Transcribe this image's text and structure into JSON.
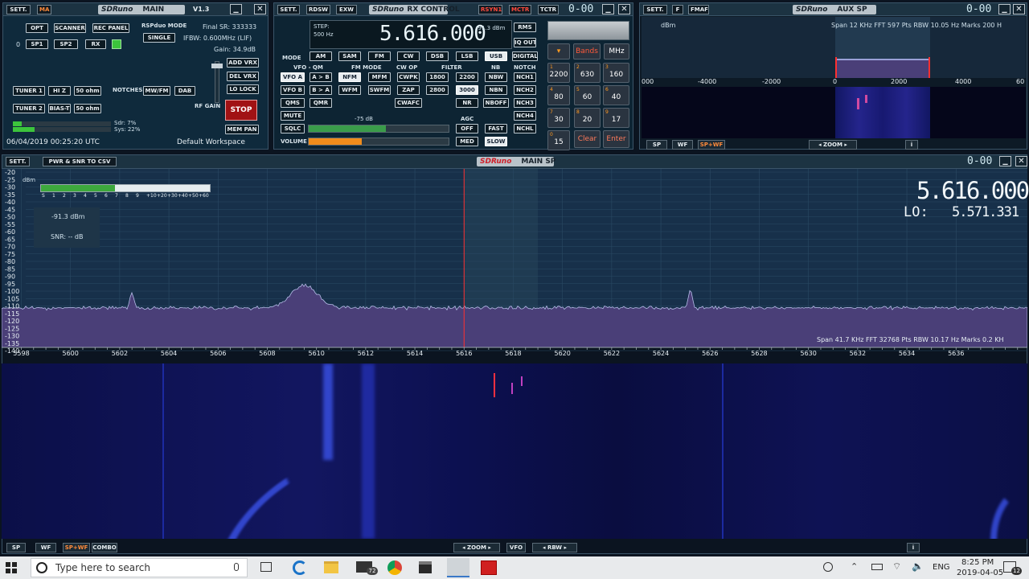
{
  "main_panel": {
    "sett": "SETT.",
    "ma": "MA",
    "logo": "SDRuno",
    "title": "MAIN",
    "version": "V1.3",
    "buttons": {
      "opt": "OPT",
      "scanner": "SCANNER",
      "rec_panel": "REC PANEL",
      "sp1": "SP1",
      "sp2": "SP2",
      "rx": "RX",
      "add_vrx": "ADD VRX",
      "del_vrx": "DEL VRX",
      "lo_lock": "LO LOCK",
      "stop": "STOP",
      "mem_pan": "MEM PAN",
      "tuner1": "TUNER 1",
      "hiz2": "HI Z",
      "ohm1": "50 ohm",
      "notches": "NOTCHES",
      "mwfm": "MW/FM",
      "dab": "DAB",
      "tuner2": "TUNER 2",
      "biast": "BIAS-T",
      "ohm2": "50 ohm",
      "single": "SINGLE"
    },
    "rx_index": "0",
    "rsp_mode_label": "RSPduo MODE",
    "final_sr": "Final SR: 333333",
    "ifbw": "IFBW: 0.600MHz (LIF)",
    "gain": "Gain: 34.9dB",
    "rf_gain_label": "RF GAIN",
    "sdr_load": "Sdr: 7%",
    "sys_load": "Sys: 22%",
    "datetime": "06/04/2019 00:25:20 UTC",
    "workspace": "Default Workspace"
  },
  "rx_control": {
    "sett": "SETT.",
    "rdsw": "RDSW",
    "exw": "EXW",
    "logo": "SDRuno",
    "title": "RX CONTROL",
    "rsyn1": "RSYN1",
    "mctr": "MCTR",
    "tctr": "TCTR",
    "vrx_id": "0-00",
    "step_label": "STEP:",
    "step_value": "500 Hz",
    "frequency": "5.616.000",
    "signal_dbm": "-91.3 dBm",
    "rms": "RMS",
    "iq_out": "IQ OUT",
    "digital": "DIGITAL",
    "mode_label": "MODE",
    "modes": [
      "AM",
      "SAM",
      "FM",
      "CW",
      "DSB",
      "LSB",
      "USB"
    ],
    "vfo_qm_label": "VFO - QM",
    "fm_mode_label": "FM MODE",
    "cw_op_label": "CW OP",
    "filter_label": "FILTER",
    "nb_label": "NB",
    "notch_label": "NOTCH",
    "vfo_a": "VFO A",
    "a_to_b": "A > B",
    "nfm": "NFM",
    "mfm": "MFM",
    "cwpk": "CWPK",
    "f1800": "1800",
    "f2200": "2200",
    "nbw": "NBW",
    "nch1": "NCH1",
    "vfo_b": "VFO B",
    "b_to_a": "B > A",
    "wfm": "WFM",
    "swfm": "SWFM",
    "zap": "ZAP",
    "f2800": "2800",
    "f3000": "3000",
    "nbn": "NBN",
    "nch2": "NCH2",
    "qms": "QMS",
    "qmr": "QMR",
    "cwafc": "CWAFC",
    "nr": "NR",
    "nboff": "NBOFF",
    "nch3": "NCH3",
    "nch4": "NCH4",
    "mute": "MUTE",
    "sqlc": "SQLC",
    "sql_level": "-75 dB",
    "volume": "VOLUME",
    "agc_label": "AGC",
    "agc_off": "OFF",
    "agc_fast": "FAST",
    "agc_med": "MED",
    "agc_slow": "SLOW",
    "nchl": "NCHL",
    "sql_fill": 0.55,
    "vol_fill": 0.38,
    "keypad": {
      "bands": "Bands",
      "mhz": "MHz",
      "clear": "Clear",
      "enter": "Enter",
      "keys": [
        "2200",
        "630",
        "160",
        "80",
        "60",
        "40",
        "30",
        "20",
        "17",
        "15"
      ],
      "key_digits": [
        "",
        "1",
        "2",
        "3",
        "4",
        "5",
        "6",
        "7",
        "8",
        "9",
        "0"
      ]
    }
  },
  "aux_sp": {
    "sett": "SETT.",
    "f": "F",
    "fmaf": "FMAF",
    "logo": "SDRuno",
    "title": "AUX SP",
    "vrx_id": "0-00",
    "unit": "dBm",
    "info": "Span 12 KHz  FFT 597 Pts  RBW 10.05 Hz  Marks 200 H",
    "x_ticks": [
      "000",
      "-4000",
      "-2000",
      "0",
      "2000",
      "4000",
      "60"
    ],
    "sp": "SP",
    "wf": "WF",
    "spwf": "SP+WF",
    "zoom": "ZOOM"
  },
  "main_sp": {
    "sett": "SETT.",
    "pwr_snr": "PWR & SNR TO CSV",
    "logo": "SDRuno",
    "title": "MAIN SP",
    "vrx_id": "0-00",
    "unit": "dBm",
    "smeter_labels": [
      "S",
      "1",
      "2",
      "3",
      "4",
      "5",
      "6",
      "7",
      "8",
      "9",
      "+10",
      "+20",
      "+30",
      "+40",
      "+50",
      "+60"
    ],
    "smeter_fill": 0.44,
    "power": "-91.3 dBm",
    "snr": "SNR: -- dB",
    "vfo_freq": "5.616.000",
    "lo_label": "LO:",
    "lo_freq": "5.571.331",
    "info": "Span 41.7 KHz  FFT 32768 Pts  RBW 10.17 Hz  Marks 0.2 KH",
    "sp": "SP",
    "wf": "WF",
    "spwf": "SP+WF",
    "combo": "COMBO",
    "zoom": "ZOOM",
    "vfo": "VFO",
    "rbw": "RBW"
  },
  "chart_data": {
    "type": "line",
    "unit": "dBm",
    "y_ticks": [
      "-20",
      "-25",
      "-30",
      "-35",
      "-40",
      "-45",
      "-50",
      "-55",
      "-60",
      "-65",
      "-70",
      "-75",
      "-80",
      "-85",
      "-90",
      "-95",
      "-100",
      "-105",
      "-110",
      "-115",
      "-120",
      "-125",
      "-130",
      "-135",
      "-140"
    ],
    "x_ticks": [
      "5598",
      "5600",
      "5602",
      "5604",
      "5606",
      "5608",
      "5610",
      "5612",
      "5614",
      "5616",
      "5618",
      "5620",
      "5622",
      "5624",
      "5626",
      "5628",
      "5630",
      "5632",
      "5634",
      "5636"
    ],
    "xlim": [
      5597.2,
      5638.9
    ],
    "ylim": [
      -140,
      -20
    ],
    "noise_floor": -112,
    "peaks": [
      {
        "x": 5602.5,
        "y": -101
      },
      {
        "x": 5609.5,
        "y": -96
      },
      {
        "x": 5625.2,
        "y": -99
      }
    ],
    "tuned_frequency": 5616.0,
    "filter_bandwidth_hz": 3000
  },
  "taskbar": {
    "search_placeholder": "Type here to search",
    "lang": "ENG",
    "time": "8:25 PM",
    "date": "2019-04-05",
    "mail_badge": "72",
    "notif_badge": "12"
  },
  "colors": {
    "accent_green": "#3cc43c",
    "volume_orange": "#f08c1c",
    "stop_red": "#a11214",
    "spectrum_fill": "#4a3f78",
    "waterfall_bg": "#0a0d3a",
    "tuned_marker": "#ff3030"
  }
}
